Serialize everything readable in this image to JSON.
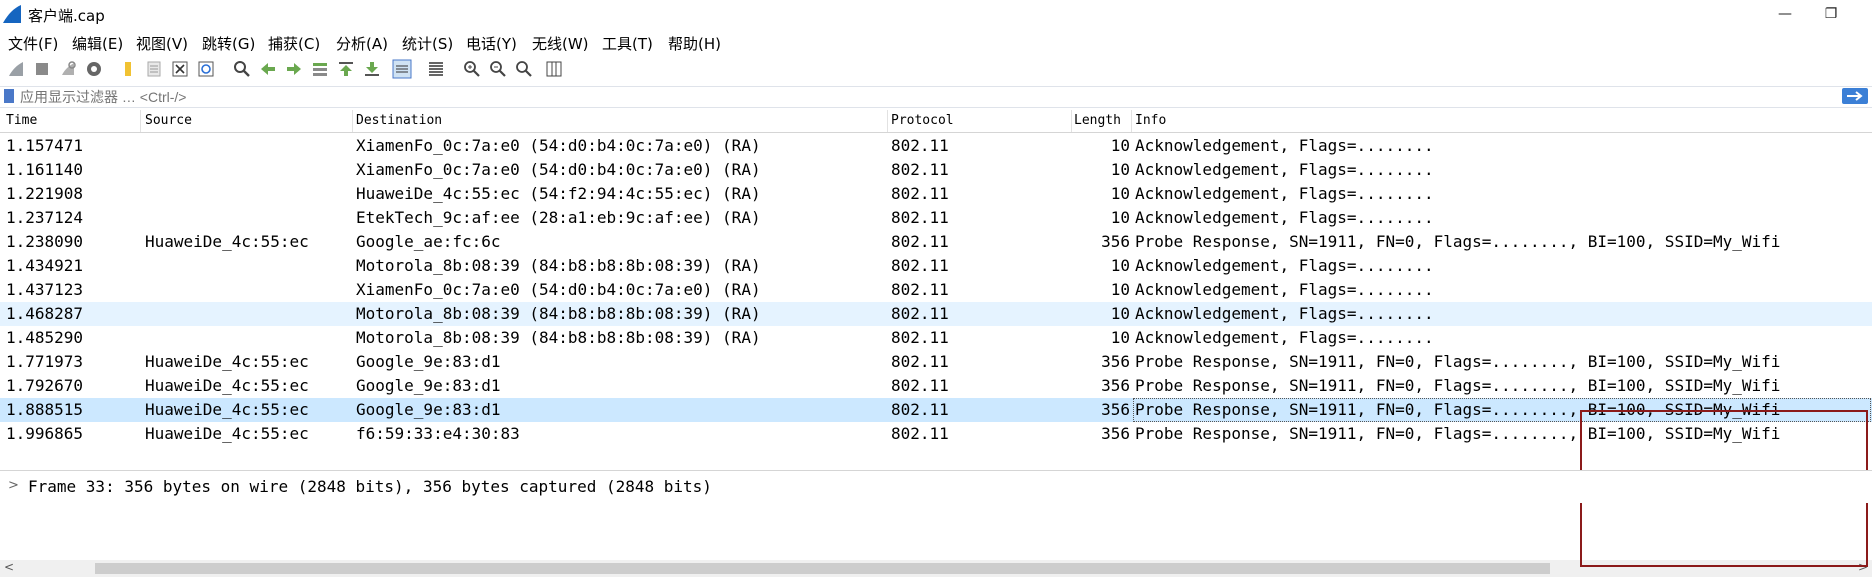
{
  "window": {
    "title": "客户端.cap",
    "minimize_glyph": "—",
    "restore_glyph": "❐"
  },
  "menu": [
    "文件(F)",
    "编辑(E)",
    "视图(V)",
    "跳转(G)",
    "捕获(C)",
    "分析(A)",
    "统计(S)",
    "电话(Y)",
    "无线(W)",
    "工具(T)",
    "帮助(H)"
  ],
  "toolbar": {
    "icons": [
      "start-capture-icon",
      "stop-capture-icon",
      "restart-capture-icon",
      "capture-options-icon",
      "open-file-icon",
      "save-file-icon",
      "close-file-icon",
      "reload-file-icon",
      "find-packet-icon",
      "go-back-icon",
      "go-forward-icon",
      "go-to-packet-icon",
      "go-first-icon",
      "go-last-icon",
      "auto-scroll-icon",
      "colorize-icon",
      "zoom-in-icon",
      "zoom-out-icon",
      "normal-size-icon",
      "resize-columns-icon"
    ]
  },
  "filter": {
    "placeholder": "应用显示过滤器 … <Ctrl-/>",
    "value": ""
  },
  "columns": [
    "Time",
    "Source",
    "Destination",
    "Protocol",
    "Length",
    "Info"
  ],
  "packets": [
    {
      "time": "1.157471",
      "source": "",
      "destination": "XiamenFo_0c:7a:e0 (54:d0:b4:0c:7a:e0) (RA)",
      "protocol": "802.11",
      "length": "10",
      "info": "Acknowledgement, Flags=........",
      "state": "normal"
    },
    {
      "time": "1.161140",
      "source": "",
      "destination": "XiamenFo_0c:7a:e0 (54:d0:b4:0c:7a:e0) (RA)",
      "protocol": "802.11",
      "length": "10",
      "info": "Acknowledgement, Flags=........",
      "state": "normal"
    },
    {
      "time": "1.221908",
      "source": "",
      "destination": "HuaweiDe_4c:55:ec (54:f2:94:4c:55:ec) (RA)",
      "protocol": "802.11",
      "length": "10",
      "info": "Acknowledgement, Flags=........",
      "state": "normal"
    },
    {
      "time": "1.237124",
      "source": "",
      "destination": "EtekTech_9c:af:ee (28:a1:eb:9c:af:ee) (RA)",
      "protocol": "802.11",
      "length": "10",
      "info": "Acknowledgement, Flags=........",
      "state": "normal"
    },
    {
      "time": "1.238090",
      "source": "HuaweiDe_4c:55:ec",
      "destination": "Google_ae:fc:6c",
      "protocol": "802.11",
      "length": "356",
      "info": "Probe Response, SN=1911, FN=0, Flags=........, BI=100, SSID=My_Wifi",
      "state": "normal"
    },
    {
      "time": "1.434921",
      "source": "",
      "destination": "Motorola_8b:08:39 (84:b8:b8:8b:08:39) (RA)",
      "protocol": "802.11",
      "length": "10",
      "info": "Acknowledgement, Flags=........",
      "state": "normal"
    },
    {
      "time": "1.437123",
      "source": "",
      "destination": "XiamenFo_0c:7a:e0 (54:d0:b4:0c:7a:e0) (RA)",
      "protocol": "802.11",
      "length": "10",
      "info": "Acknowledgement, Flags=........",
      "state": "normal"
    },
    {
      "time": "1.468287",
      "source": "",
      "destination": "Motorola_8b:08:39 (84:b8:b8:8b:08:39) (RA)",
      "protocol": "802.11",
      "length": "10",
      "info": "Acknowledgement, Flags=........",
      "state": "hover"
    },
    {
      "time": "1.485290",
      "source": "",
      "destination": "Motorola_8b:08:39 (84:b8:b8:8b:08:39) (RA)",
      "protocol": "802.11",
      "length": "10",
      "info": "Acknowledgement, Flags=........",
      "state": "normal"
    },
    {
      "time": "1.771973",
      "source": "HuaweiDe_4c:55:ec",
      "destination": "Google_9e:83:d1",
      "protocol": "802.11",
      "length": "356",
      "info": "Probe Response, SN=1911, FN=0, Flags=........, BI=100, SSID=My_Wifi",
      "state": "normal"
    },
    {
      "time": "1.792670",
      "source": "HuaweiDe_4c:55:ec",
      "destination": "Google_9e:83:d1",
      "protocol": "802.11",
      "length": "356",
      "info": "Probe Response, SN=1911, FN=0, Flags=........, BI=100, SSID=My_Wifi",
      "state": "normal"
    },
    {
      "time": "1.888515",
      "source": "HuaweiDe_4c:55:ec",
      "destination": "Google_9e:83:d1",
      "protocol": "802.11",
      "length": "356",
      "info": "Probe Response, SN=1911, FN=0, Flags=........, BI=100, SSID=My_Wifi",
      "state": "selected"
    },
    {
      "time": "1.996865",
      "source": "HuaweiDe_4c:55:ec",
      "destination": "f6:59:33:e4:30:83",
      "protocol": "802.11",
      "length": "356",
      "info": "Probe Response, SN=1911, FN=0, Flags=........, BI=100, SSID=My_Wifi",
      "state": "normal"
    }
  ],
  "details": {
    "expander_glyph": ">",
    "frame_summary": "Frame 33: 356 bytes on wire (2848 bits), 356 bytes captured (2848 bits)"
  },
  "colors": {
    "selected_row": "#cce8ff",
    "hover_row": "#e5f3ff",
    "annotation_border": "#8b1a1a",
    "accent": "#3b7fd6"
  }
}
